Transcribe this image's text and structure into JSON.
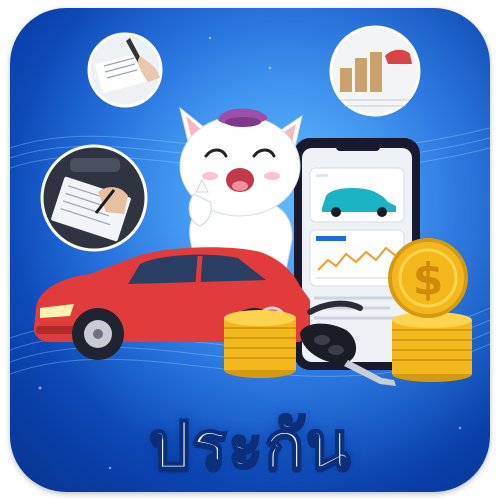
{
  "icon": {
    "title": "ประกัน",
    "colors": {
      "background": "#1560d8",
      "car": "#e23b3b",
      "phone": "#1a1a2e",
      "coin": "#f4b81f",
      "cat_hat": "#9b4fa8"
    },
    "illustrations": [
      "contract-signing-photo",
      "coin-stacks-photo",
      "form-filling-photo",
      "mascot-cat",
      "red-car",
      "smartphone-with-car-card",
      "dollar-coin",
      "coin-stacks",
      "car-key"
    ]
  }
}
